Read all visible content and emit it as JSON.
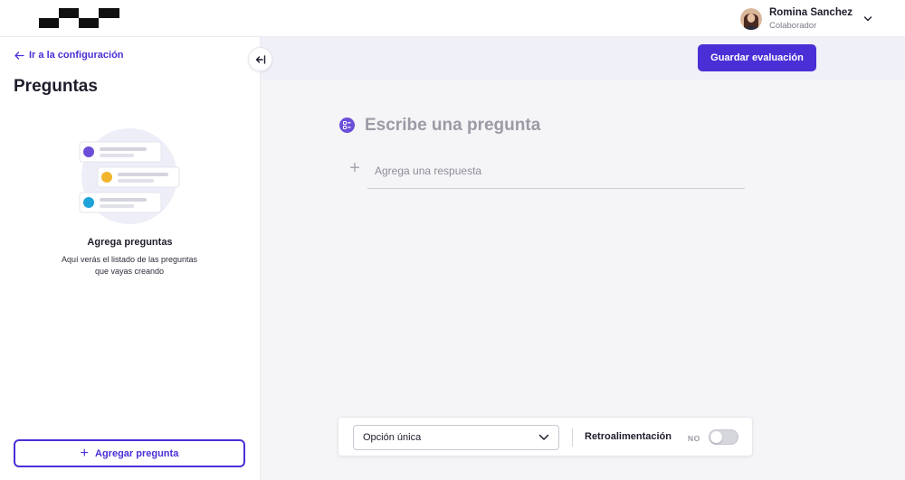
{
  "header": {
    "logo_icon": "brand-logo-blocks",
    "user": {
      "name": "Romina Sanchez",
      "role": "Colaborador",
      "avatar_icon": "user-avatar",
      "menu_icon": "chevron-down-icon"
    }
  },
  "sidebar": {
    "back_link": "Ir a la configuración",
    "title": "Preguntas",
    "collapse_icon": "collapse-left-icon",
    "empty_state": {
      "title": "Agrega preguntas",
      "description": "Aquí verás el listado de las preguntas que vayas creando"
    },
    "add_button": "Agregar pregunta"
  },
  "main": {
    "save_button": "Guardar evaluación",
    "question_placeholder": "Escribe una pregunta",
    "answer_placeholder": "Agrega una respuesta"
  },
  "bottom_panel": {
    "type_select_value": "Opción única",
    "feedback_label": "Retroalimentación",
    "toggle_state": "NO",
    "toggle_on": false
  },
  "colors": {
    "accent": "#4a2fd6",
    "topbar_bg": "#f0f0f8",
    "page_bg": "#f5f5f7"
  }
}
